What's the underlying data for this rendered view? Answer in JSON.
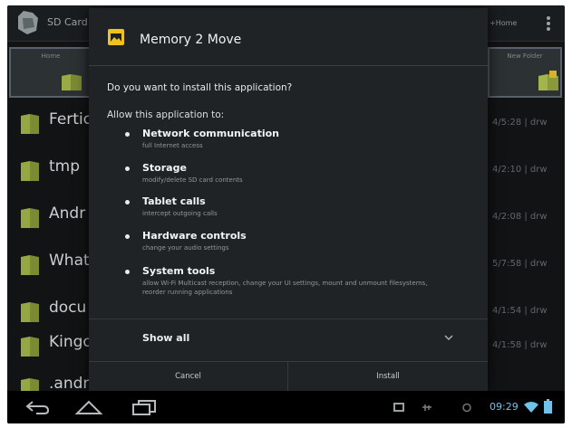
{
  "action_bar": {
    "title": "SD Card",
    "right_text": "+Home"
  },
  "toolbar": {
    "left_label": "Home",
    "right_label": "New Folder"
  },
  "files": [
    {
      "name": "Fertic",
      "meta": "4/5:28 | drw"
    },
    {
      "name": "tmp",
      "meta": "4/2:10 | drw"
    },
    {
      "name": "Andr",
      "meta": "4/2:08 | drw"
    },
    {
      "name": "What",
      "meta": "5/7:58 | drw"
    },
    {
      "name": "docu",
      "meta": "4/1:54 | drw"
    },
    {
      "name": "Kingo",
      "meta": "4/1:58 | drw"
    },
    {
      "name": ".andr",
      "meta": ""
    }
  ],
  "dialog": {
    "title": "Memory 2 Move",
    "question": "Do you want to install this application?",
    "allow_heading": "Allow this application to:",
    "permissions": [
      {
        "title": "Network communication",
        "desc": "full Internet access"
      },
      {
        "title": "Storage",
        "desc": "modify/delete SD card contents"
      },
      {
        "title": "Tablet calls",
        "desc": "intercept outgoing calls"
      },
      {
        "title": "Hardware controls",
        "desc": "change your audio settings"
      },
      {
        "title": "System tools",
        "desc": "allow Wi-Fi Multicast reception, change your UI settings, mount and unmount filesystems, reorder running applications"
      }
    ],
    "show_all_label": "Show all",
    "cancel_label": "Cancel",
    "install_label": "Install"
  },
  "status_bar": {
    "time": "09:29"
  },
  "colors": {
    "accent": "#6fc3e8",
    "folder": "#8a9a3a",
    "dialog_bg": "#202325"
  }
}
